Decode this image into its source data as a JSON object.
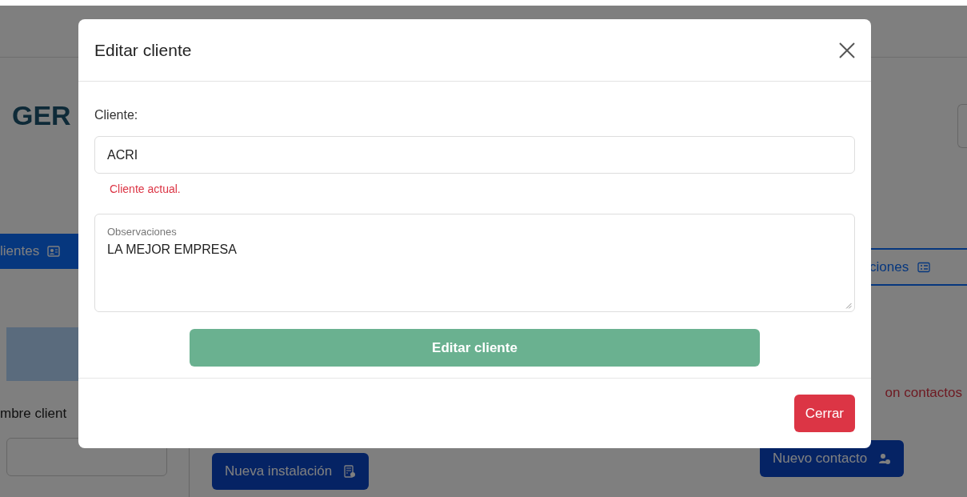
{
  "background": {
    "title": "GER",
    "tabs": [
      {
        "label": "lientes",
        "selected": true
      },
      {
        "label": "ciones",
        "selected": false
      }
    ],
    "name_label": "mbre client",
    "warning": "on contactos",
    "buttons": [
      "Nueva instalación",
      "Nuevo contacto"
    ]
  },
  "modal": {
    "title": "Editar cliente",
    "client_label": "Cliente:",
    "client_value": "ACRI",
    "client_feedback": "Cliente actual.",
    "notes_label": "Observaciones",
    "notes_value": "LA MEJOR EMPRESA",
    "submit": "Editar cliente",
    "close": "Cerrar"
  }
}
